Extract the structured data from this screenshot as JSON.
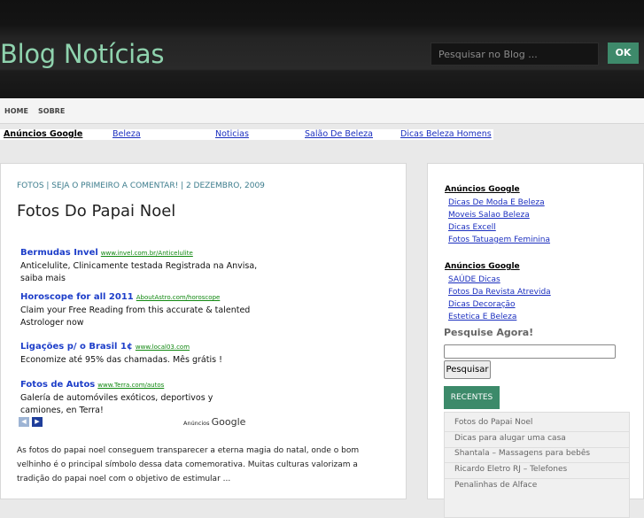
{
  "header": {
    "title": "Blog Notícias",
    "search_placeholder": "Pesquisar no Blog ...",
    "ok_label": "OK"
  },
  "nav": {
    "items": [
      "HOME",
      "SOBRE"
    ]
  },
  "adbar": {
    "label": "Anúncios Google",
    "links": [
      "Beleza",
      "Noticias",
      "Salão De Beleza",
      "Dicas Beleza Homens"
    ]
  },
  "post": {
    "meta": "FOTOS | SEJA O PRIMEIRO A COMENTAR! | 2 DEZEMBRO, 2009",
    "title": "Fotos Do Papai Noel",
    "ads": [
      {
        "title": "Bermudas Invel",
        "url": "www.invel.com.br/Anticelulite",
        "desc": "Anticelulite, Clinicamente testada Registrada na Anvisa, saiba mais"
      },
      {
        "title": "Horoscope for all 2011",
        "url": "AboutAstro.com/horoscope",
        "desc": "Claim your Free Reading from this accurate & talented Astrologer now"
      },
      {
        "title": "Ligações p/ o Brasil 1¢",
        "url": "www.local03.com",
        "desc": "Economize até 95% das chamadas. Mês grátis !"
      },
      {
        "title": "Fotos de Autos",
        "url": "www.Terra.com/autos",
        "desc": "Galería de automóviles exóticos, deportivos y camiones, en Terra!"
      }
    ],
    "ads_prev": "◀",
    "ads_next": "▶",
    "ads_brand_prefix": "Anúncios",
    "ads_brand": "Google",
    "excerpt": "As fotos do papai noel conseguem transparecer a eterna magia do natal, onde o bom velhinho é o principal símbolo dessa data comemorativa. Muitas culturas valorizam a tradição do papai noel com o objetivo de estimular ..."
  },
  "sidebar": {
    "group1": {
      "heading": "Anúncios Google",
      "links": [
        "Dicas De Moda E Beleza",
        "Moveis Salao Beleza",
        "Dicas Excell",
        "Fotos Tatuagem Feminina"
      ]
    },
    "group2": {
      "heading": "Anúncios Google",
      "links": [
        "SAÚDE Dicas",
        "Fotos Da Revista Atrevida",
        "Dicas Decoração",
        "Estetica E Beleza"
      ]
    },
    "search_heading": "Pesquise Agora!",
    "search_button": "Pesquisar",
    "recent_tab": "RECENTES",
    "recent": [
      "Fotos do Papai Noel",
      "Dicas para alugar uma casa",
      "Shantala – Massagens para bebês",
      "Ricardo Eletro RJ – Telefones",
      "Penalinhas de Alface"
    ]
  },
  "colors": {
    "accent_green": "#3e8a6b",
    "title_green": "#8fd3ae",
    "link_blue": "#1b2fbf",
    "ad_url_green": "#118811"
  }
}
